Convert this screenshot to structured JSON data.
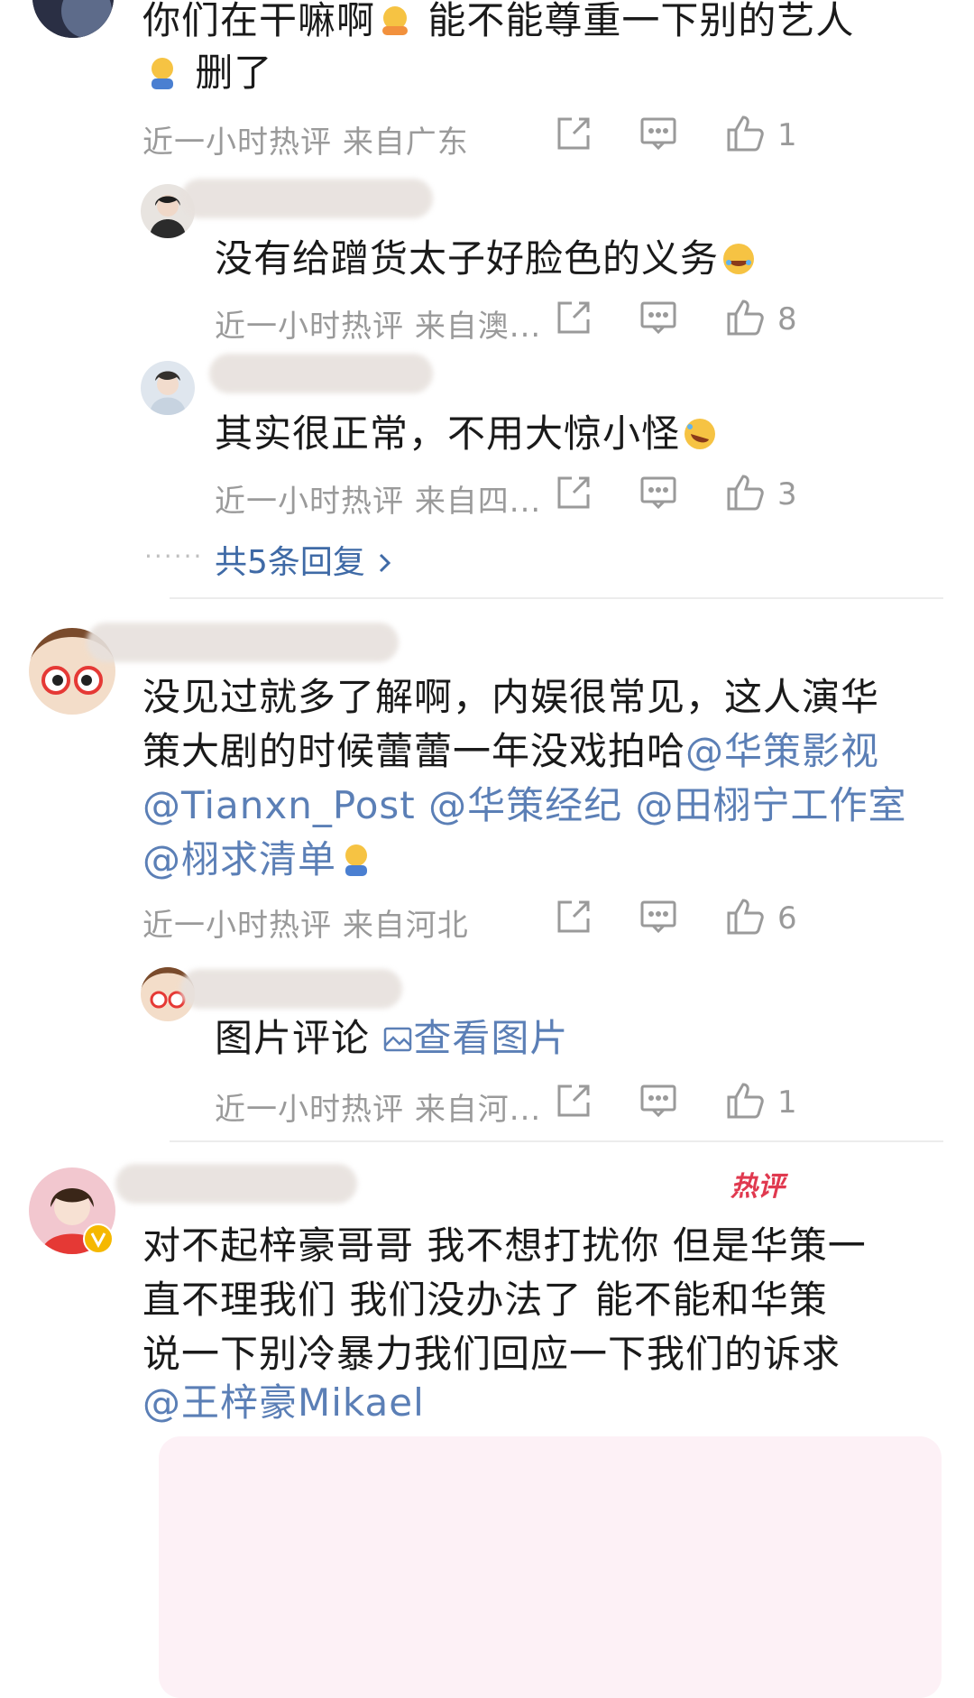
{
  "comments": [
    {
      "id": "c1",
      "text_line1": "你们在干嘛啊",
      "text_line1b": "能不能尊重一下别的艺人",
      "text_line2": "删了",
      "time": "近一小时热评",
      "location": "来自广东",
      "likes": "1",
      "replies": [
        {
          "text": "没有给蹭货太子好脸色的义务",
          "time": "近一小时热评",
          "location": "来自澳...",
          "likes": "8"
        },
        {
          "text": "其实很正常，不用大惊小怪",
          "time": "近一小时热评",
          "location": "来自四...",
          "likes": "3"
        }
      ],
      "more_replies": "共5条回复",
      "dots": "······"
    },
    {
      "id": "c2",
      "line1": "没见过就多了解啊，内娱很常见，这人演华",
      "line2a": "策大剧的时候蕾蕾一年没戏拍哈",
      "mention1": "@华策影视",
      "mention2": "@Tianxn_Post",
      "mention3": "@华策经纪",
      "mention4": "@田栩宁工作室",
      "mention5": "@栩求清单",
      "time": "近一小时热评",
      "location": "来自河北",
      "likes": "6",
      "reply": {
        "text": "图片评论",
        "link": "查看图片",
        "time": "近一小时热评",
        "location": "来自河...",
        "likes": "1"
      }
    },
    {
      "id": "c3",
      "badge": "热评",
      "line1": "对不起梓豪哥哥 我不想打扰你 但是华策一",
      "line2": "直不理我们 我们没办法了 能不能和华策",
      "line3": "说一下别冷暴力我们回应一下我们的诉求",
      "mention": "@王梓豪Mikael"
    }
  ],
  "icons": {
    "share": "share-icon",
    "comment": "comment-icon",
    "like": "thumbs-up-icon",
    "picture": "picture-icon",
    "chevron": "chevron-right-icon"
  },
  "colors": {
    "link": "#5b7fb6",
    "meta": "#9a9a9a",
    "hot": "#e0394f"
  }
}
